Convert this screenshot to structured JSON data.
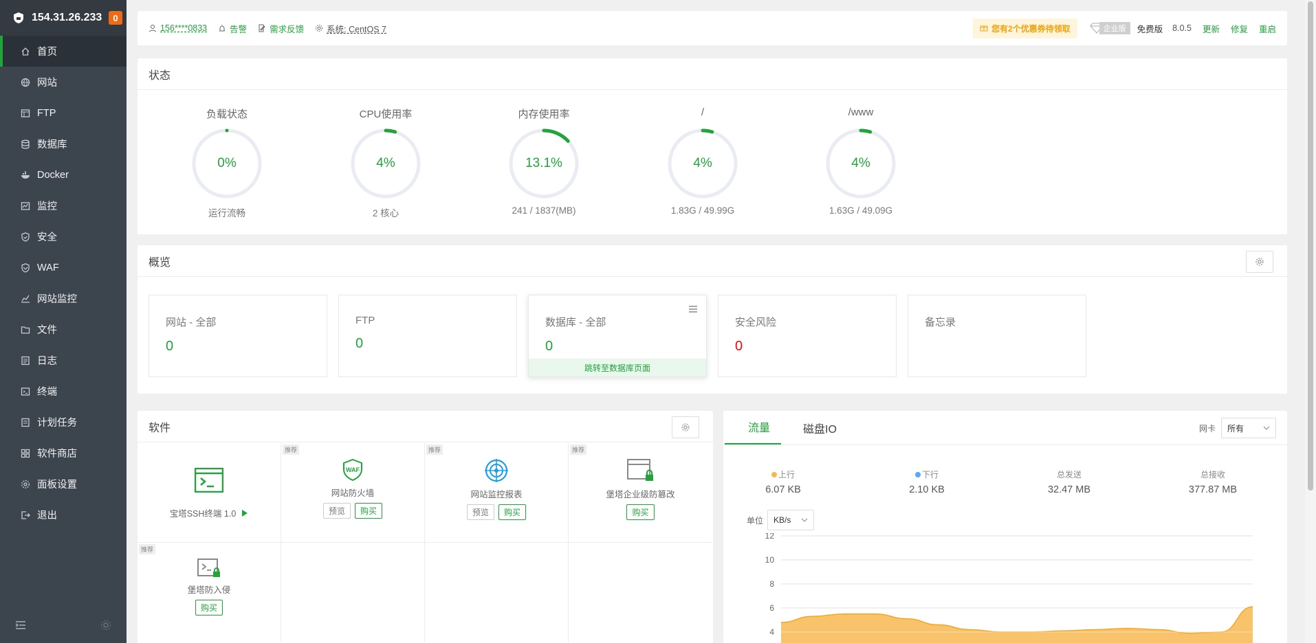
{
  "sidebar": {
    "ip": "154.31.26.233",
    "badge": "0",
    "items": [
      {
        "label": "首页",
        "icon": "home-icon"
      },
      {
        "label": "网站",
        "icon": "globe-icon"
      },
      {
        "label": "FTP",
        "icon": "ftp-icon"
      },
      {
        "label": "数据库",
        "icon": "database-icon"
      },
      {
        "label": "Docker",
        "icon": "docker-icon"
      },
      {
        "label": "监控",
        "icon": "monitor-icon"
      },
      {
        "label": "安全",
        "icon": "shield-icon"
      },
      {
        "label": "WAF",
        "icon": "waf-icon"
      },
      {
        "label": "网站监控",
        "icon": "chart-icon"
      },
      {
        "label": "文件",
        "icon": "folder-icon"
      },
      {
        "label": "日志",
        "icon": "log-icon"
      },
      {
        "label": "终端",
        "icon": "terminal-icon"
      },
      {
        "label": "计划任务",
        "icon": "task-icon"
      },
      {
        "label": "软件商店",
        "icon": "store-icon"
      },
      {
        "label": "面板设置",
        "icon": "settings-icon"
      },
      {
        "label": "退出",
        "icon": "logout-icon"
      }
    ]
  },
  "topbar": {
    "user": "156****0833",
    "alarm": "告警",
    "feedback": "需求反馈",
    "system": "系统: CentOS 7",
    "coupon": "您有2个优惠券待领取",
    "enterprise": "企业版",
    "free": "免费版",
    "version": "8.0.5",
    "update": "更新",
    "repair": "修复",
    "restart": "重启"
  },
  "status": {
    "title": "状态",
    "gauges": [
      {
        "label": "负载状态",
        "value": "0%",
        "percent": 0,
        "sub": "运行流畅"
      },
      {
        "label": "CPU使用率",
        "value": "4%",
        "percent": 4,
        "sub": "2 核心"
      },
      {
        "label": "内存使用率",
        "value": "13.1%",
        "percent": 13.1,
        "sub": "241 / 1837(MB)"
      },
      {
        "label": "/",
        "value": "4%",
        "percent": 4,
        "sub": "1.83G / 49.99G"
      },
      {
        "label": "/www",
        "value": "4%",
        "percent": 4,
        "sub": "1.63G / 49.09G"
      }
    ]
  },
  "overview": {
    "title": "概览",
    "boxes": [
      {
        "title": "网站 - 全部",
        "value": "0"
      },
      {
        "title": "FTP",
        "value": "0"
      },
      {
        "title": "数据库 - 全部",
        "value": "0",
        "link": "跳转至数据库页面"
      },
      {
        "title": "安全风险",
        "value": "0"
      },
      {
        "title": "备忘录",
        "value": ""
      }
    ]
  },
  "software": {
    "title": "软件",
    "recommend": "推荐",
    "preview": "预览",
    "buy": "购买",
    "items": [
      {
        "name": "宝塔SSH终端 1.0"
      },
      {
        "name": "网站防火墙"
      },
      {
        "name": "网站监控报表"
      },
      {
        "name": "堡塔企业级防篡改"
      },
      {
        "name": "堡塔防入侵"
      }
    ]
  },
  "traffic": {
    "tabs": [
      "流量",
      "磁盘IO"
    ],
    "nic_label": "网卡",
    "nic_value": "所有",
    "stats": [
      {
        "label": "上行",
        "value": "6.07 KB",
        "color": "#f7b851"
      },
      {
        "label": "下行",
        "value": "2.10 KB",
        "color": "#52a9ff"
      },
      {
        "label": "总发送",
        "value": "32.47 MB"
      },
      {
        "label": "总接收",
        "value": "377.87 MB"
      }
    ],
    "unit_label": "单位",
    "unit_value": "KB/s"
  },
  "chart_data": {
    "type": "area",
    "ylim": [
      0,
      12
    ],
    "yticks": [
      4,
      6,
      8,
      10,
      12
    ],
    "series": [
      {
        "name": "上行",
        "color": "#f7b851",
        "values": [
          4.8,
          5.3,
          5.5,
          5.5,
          5.1,
          4.6,
          4.2,
          4.0,
          4.0,
          4.1,
          4.2,
          4.3,
          4.2,
          3.9,
          4.0,
          6.1
        ]
      }
    ]
  }
}
